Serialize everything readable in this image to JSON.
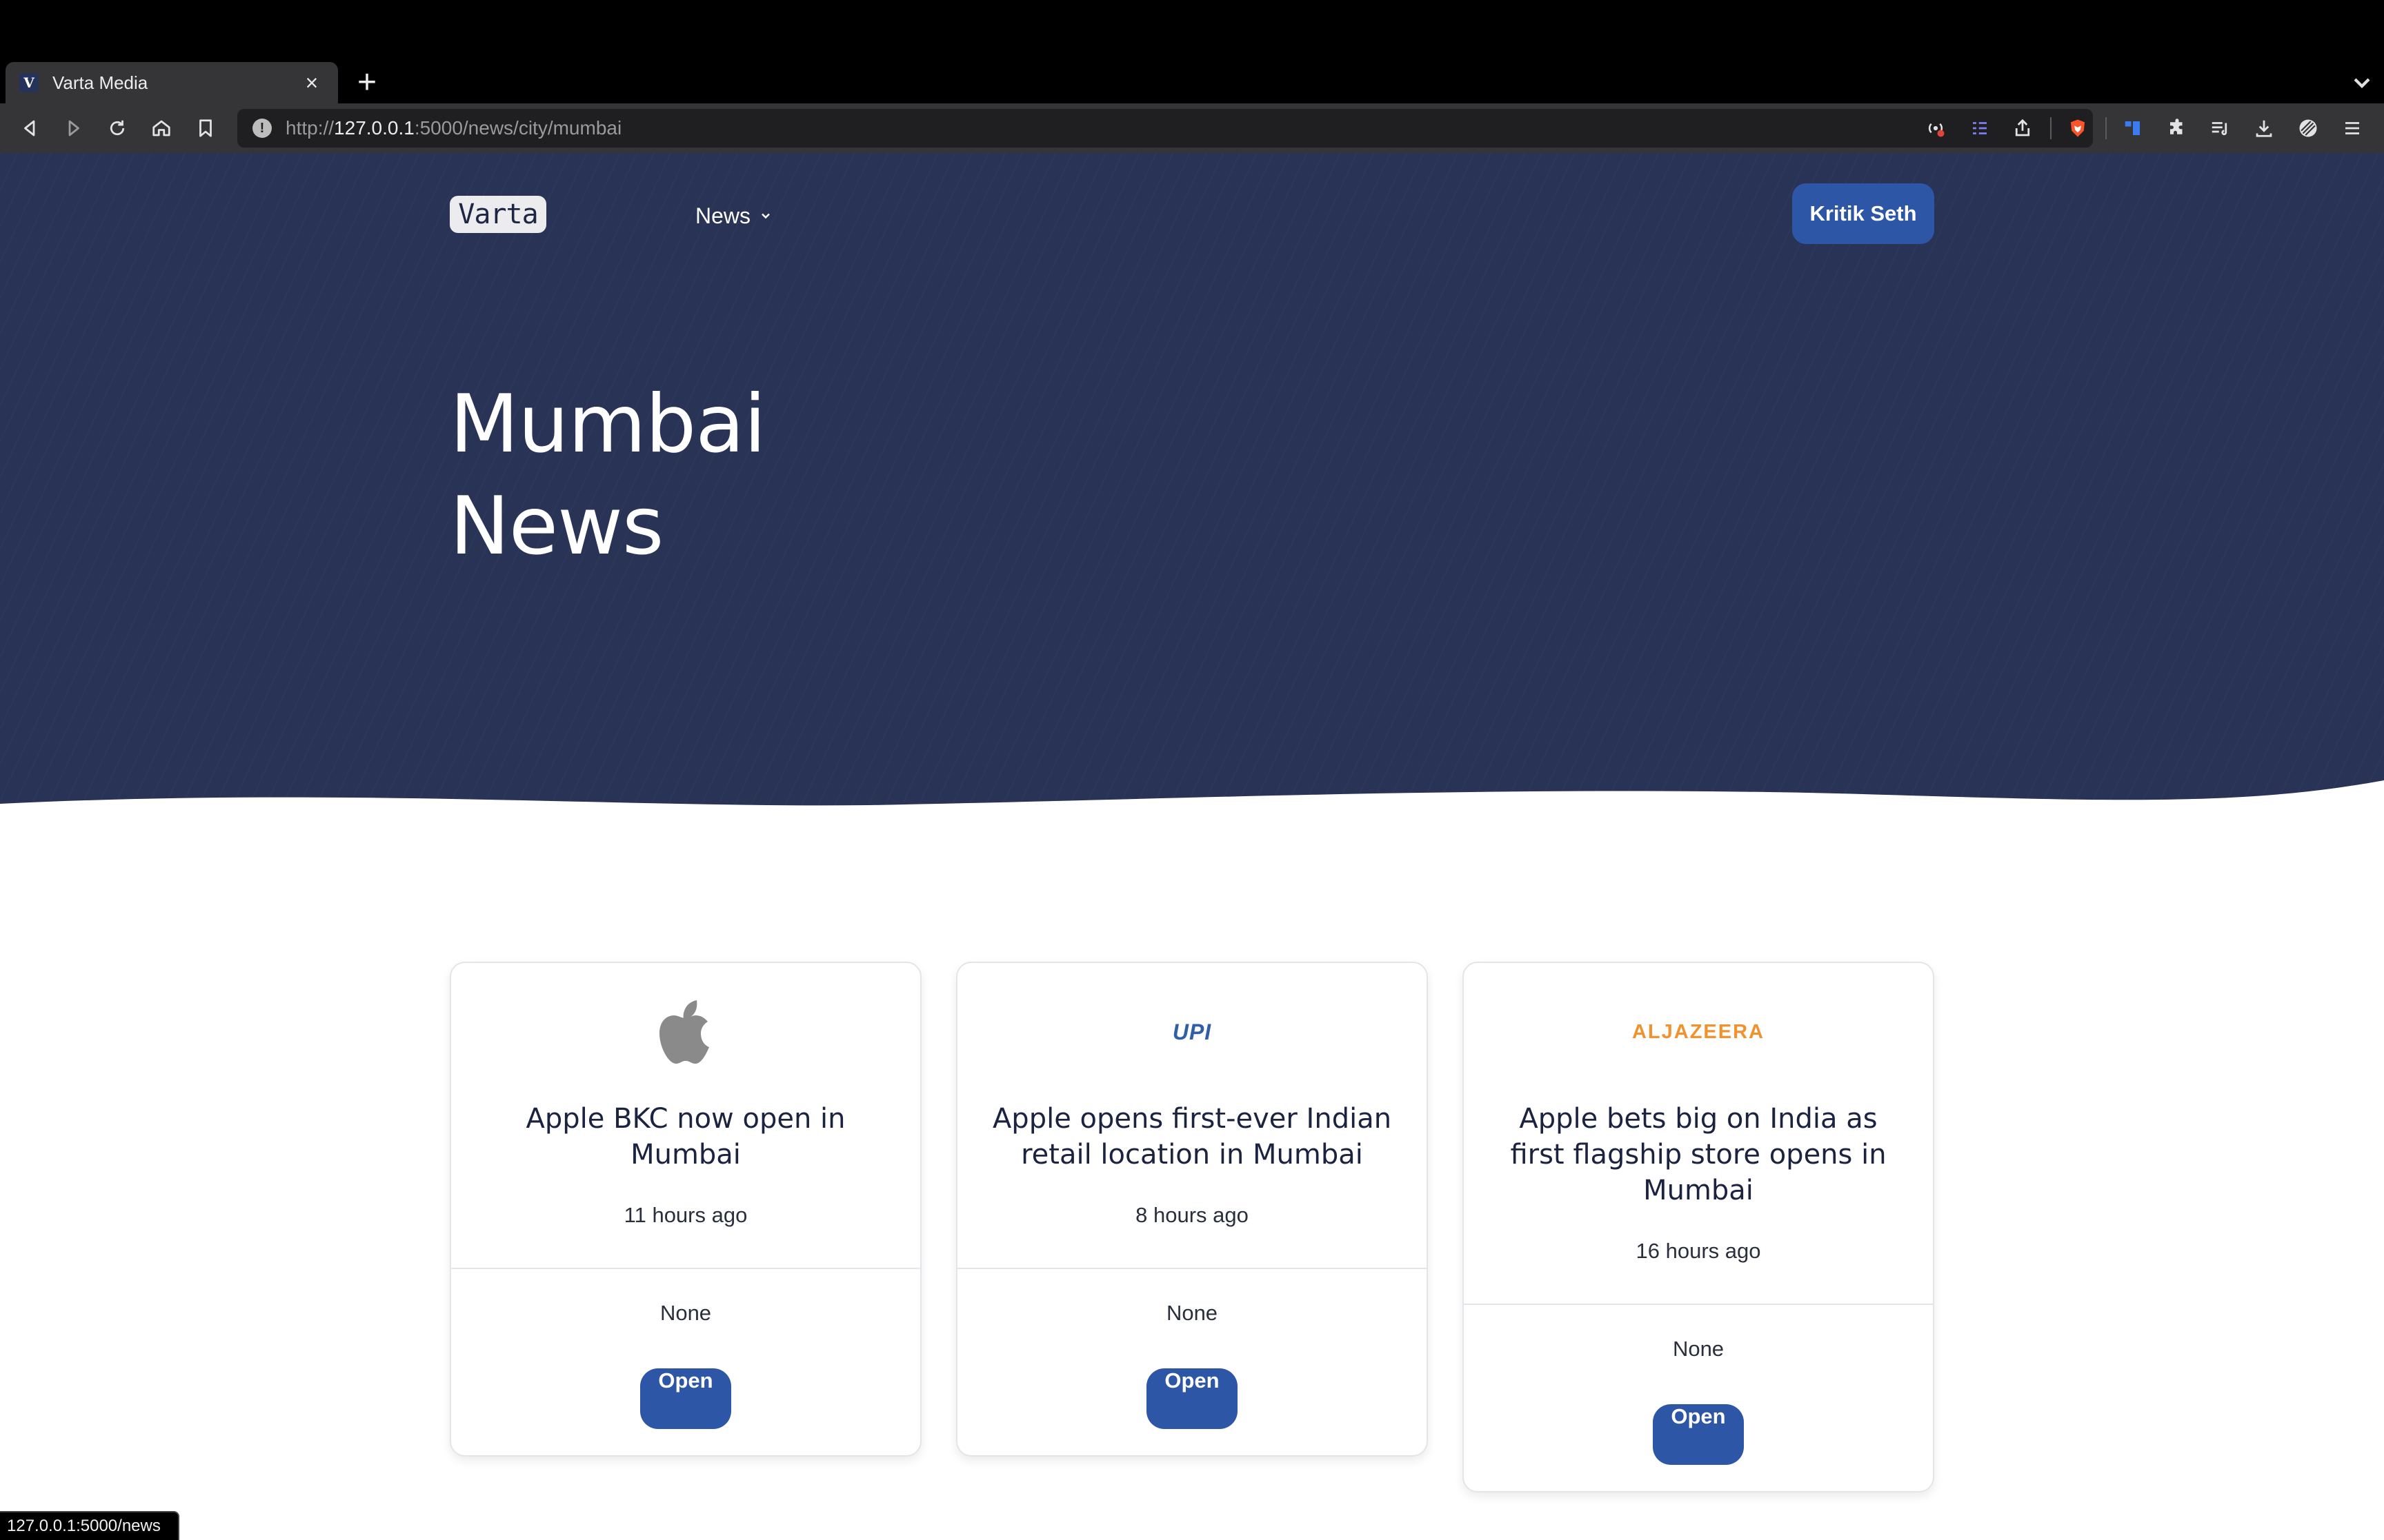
{
  "browser": {
    "tab": {
      "title": "Varta Media",
      "favicon": "V"
    },
    "url": {
      "scheme": "http://",
      "host": "127.0.0.1",
      "path": ":5000/news/city/mumbai"
    },
    "status_url": "127.0.0.1:5000/news"
  },
  "site": {
    "logo": "Varta",
    "nav": {
      "news_label": "News"
    },
    "user_label": "Kritik Seth"
  },
  "hero": {
    "title_line1": "Mumbai",
    "title_line2": "News"
  },
  "cards": [
    {
      "logo": "apple-logo",
      "title": "Apple BKC now open in Mumbai",
      "time": "11 hours ago",
      "source": "None",
      "button": "Open"
    },
    {
      "logo": "UPI",
      "title": "Apple opens first-ever Indian retail location in Mumbai",
      "time": "8 hours ago",
      "source": "None",
      "button": "Open"
    },
    {
      "logo": "ALJAZEERA",
      "title": "Apple bets big on India as first flagship store opens in Mumbai",
      "time": "16 hours ago",
      "source": "None",
      "button": "Open"
    }
  ],
  "colors": {
    "hero_bg": "#293356",
    "accent": "#2e56a6",
    "aljazeera": "#f0922d",
    "upi": "#2f5fa7"
  }
}
